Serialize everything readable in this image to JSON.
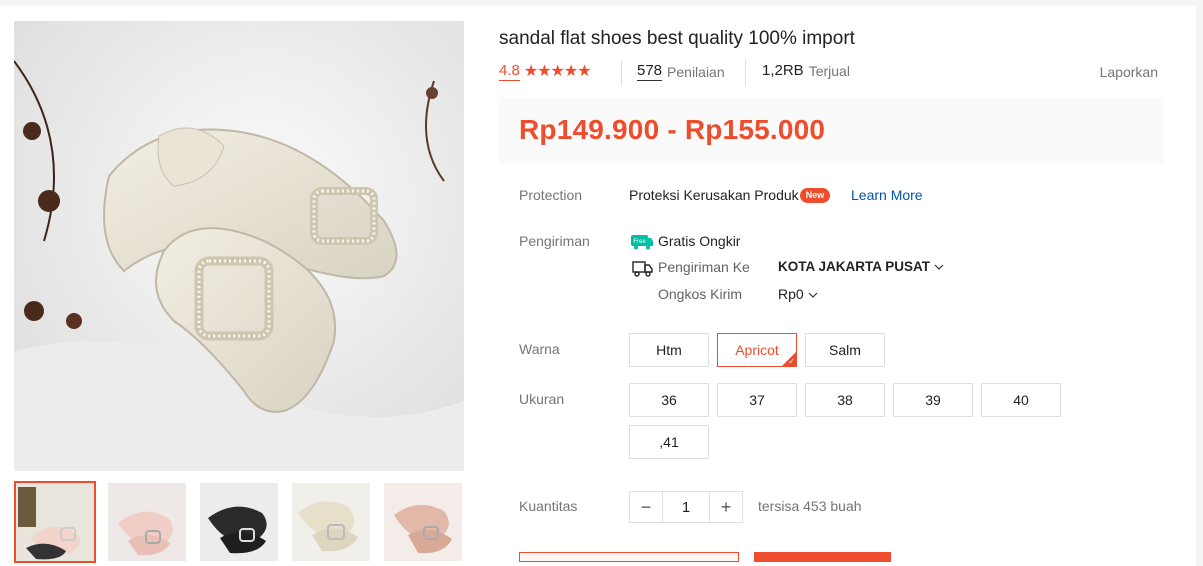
{
  "product": {
    "title": "sandal flat shoes best quality 100% import",
    "rating": "4.8",
    "stars": "★★★★★",
    "reviews_count": "578",
    "reviews_label": "Penilaian",
    "sold_count": "1,2RB",
    "sold_label": "Terjual",
    "report_label": "Laporkan",
    "price": "Rp149.900 - Rp155.000"
  },
  "protection": {
    "label": "Protection",
    "value": "Proteksi Kerusakan Produk",
    "badge": "New",
    "learn_more": "Learn More"
  },
  "shipping": {
    "label": "Pengiriman",
    "free_badge": "Free",
    "free_text": "Gratis Ongkir",
    "to_label": "Pengiriman Ke",
    "to_value": "KOTA JAKARTA PUSAT",
    "cost_label": "Ongkos Kirim",
    "cost_value": "Rp0"
  },
  "variants": {
    "color_label": "Warna",
    "colors": [
      "Htm",
      "Apricot",
      "Salm"
    ],
    "selected_color": "Apricot",
    "size_label": "Ukuran",
    "sizes": [
      "36",
      "37",
      "38",
      "39",
      "40",
      ",41"
    ]
  },
  "quantity": {
    "label": "Kuantitas",
    "minus": "−",
    "value": "1",
    "plus": "+",
    "stock_text": "tersisa 453 buah"
  },
  "colors": {
    "accent": "#ee4d2d",
    "link": "#0055aa",
    "free_badge": "#00bfa5"
  },
  "icons": {
    "truck": "truck-icon",
    "free_shipping": "free-shipping-icon",
    "chevron": "chevron-down-icon",
    "selected_check": "check-icon"
  }
}
